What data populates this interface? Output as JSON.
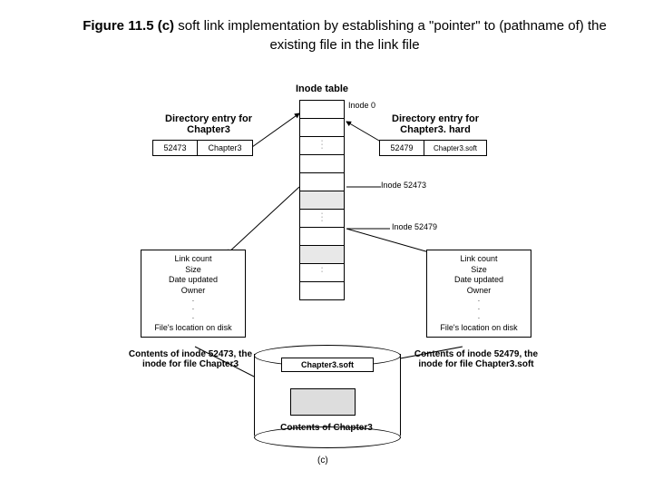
{
  "title": {
    "prefix": "Figure 11.5 (c)",
    "rest": " soft link implementation by establishing a \"pointer\" to (pathname of) the existing file in the link file"
  },
  "labels": {
    "inode_table": "Inode table",
    "inode_0": "Inode 0",
    "dir_left_title": "Directory entry for Chapter3",
    "dir_right_title": "Directory entry for Chapter3. hard",
    "de_left_num": "52473",
    "de_left_name": "Chapter3",
    "de_right_num": "52479",
    "de_right_name": "Chapter3.soft",
    "inode_52473": "Inode 52473",
    "inode_52479": "Inode 52479",
    "attr_linkcount": "Link count",
    "attr_size": "Size",
    "attr_date": "Date updated",
    "attr_owner": "Owner",
    "attr_loc": "File's location on disk",
    "contents_left": "Contents of inode 52473, the inode for file Chapter3",
    "contents_right": "Contents of inode 52479, the inode for file Chapter3.soft",
    "cyl_box_label": "Chapter3.soft",
    "cyl_caption": "Contents of Chapter3",
    "subfig": "(c)"
  }
}
